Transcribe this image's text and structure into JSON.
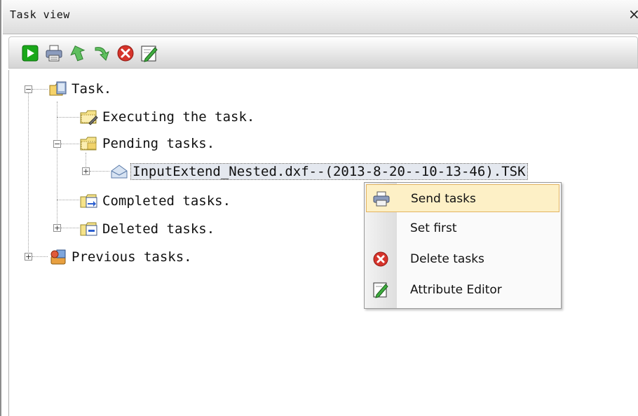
{
  "window": {
    "title": "Task view",
    "close_label": "×"
  },
  "toolbar": {
    "buttons": [
      {
        "name": "start-icon",
        "color": "#1aa81a"
      },
      {
        "name": "printer-icon",
        "color": "#5b6f99"
      },
      {
        "name": "move-up-icon",
        "color": "#3a9a3a"
      },
      {
        "name": "move-down-icon",
        "color": "#3a9a3a"
      },
      {
        "name": "delete-icon",
        "color": "#d6342b"
      },
      {
        "name": "attribute-editor-icon",
        "color": "#2f8a2f"
      }
    ]
  },
  "tree": {
    "root": {
      "label": "Task.",
      "expander": "−"
    },
    "executing": {
      "label": "Executing the task."
    },
    "pending": {
      "label": "Pending tasks.",
      "expander": "−"
    },
    "task_file": {
      "label": "InputExtend_Nested.dxf--(2013-8-20--10-13-46).TSK",
      "expander": "+"
    },
    "completed": {
      "label": "Completed tasks."
    },
    "deleted": {
      "label": "Deleted tasks.",
      "expander": "+"
    },
    "previous": {
      "label": "Previous tasks.",
      "expander": "+"
    }
  },
  "context_menu": {
    "items": [
      {
        "label": "Send tasks",
        "icon": "printer-icon"
      },
      {
        "label": "Set first",
        "icon": ""
      },
      {
        "label": "Delete tasks",
        "icon": "delete-icon"
      },
      {
        "label": "Attribute Editor",
        "icon": "attribute-editor-icon"
      }
    ]
  }
}
